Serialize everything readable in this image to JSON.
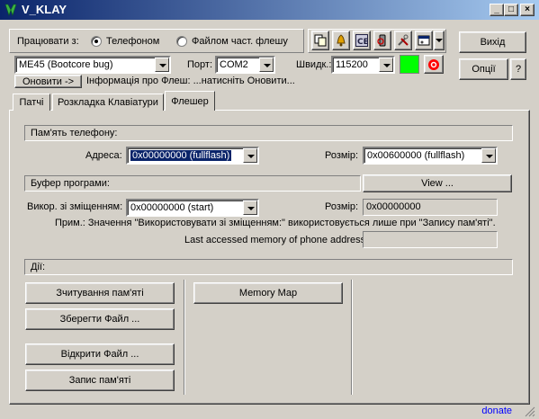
{
  "window": {
    "title": "V_KLAY"
  },
  "mode": {
    "label": "Працювати з:",
    "option_phone": "Телефоном",
    "option_flash": "Файлом част. флешу",
    "selected": "phone"
  },
  "model_combo": {
    "value": "ME45 (Bootcore bug)"
  },
  "port": {
    "label": "Порт:",
    "value": "COM2"
  },
  "speed": {
    "label": "Швидк.:",
    "value": "115200"
  },
  "status_colors": {
    "indicator": "#00ff00",
    "stop": "#ff0000"
  },
  "toolbar_icons": [
    "copy-icon",
    "bell-icon",
    "ce-icon",
    "phone-search-icon",
    "tools-icon",
    "window-icon"
  ],
  "buttons": {
    "exit": "Вихід",
    "options": "Опції",
    "help": "?",
    "update": "Оновити ->"
  },
  "flash_info": "Інформація про Флеш: ...натисніть Оновити...",
  "tabs": [
    "Патчі",
    "Розкладка Клавіатури",
    "Флешер"
  ],
  "active_tab": "Флешер",
  "phone_memory": {
    "header": "Пам'ять телефону:",
    "address_label": "Адреса:",
    "address_value": "0x00000000 (fullflash)",
    "size_label": "Розмір:",
    "size_value": "0x00600000 (fullflash)"
  },
  "program_buffer": {
    "header": "Буфер програми:",
    "view_button": "View ...",
    "offset_label": "Викор. зі зміщенням:",
    "offset_value": "0x00000000 (start)",
    "size_label": "Розмір:",
    "size_value": "0x00000000",
    "note": "Прим.: Значення \"Використовувати зі зміщенням:\" використовується лише при \"Запису пам'яті\".",
    "last_accessed_label": "Last accessed memory of phone address:",
    "last_accessed_value": ""
  },
  "actions": {
    "header": "Дії:",
    "read_memory": "Зчитування пам'яті",
    "save_file": "Зберегти Файл ...",
    "open_file": "Відкрити Файл ...",
    "write_memory": "Запис пам'яті",
    "memory_map": "Memory Map"
  },
  "status": {
    "donate": "donate"
  }
}
